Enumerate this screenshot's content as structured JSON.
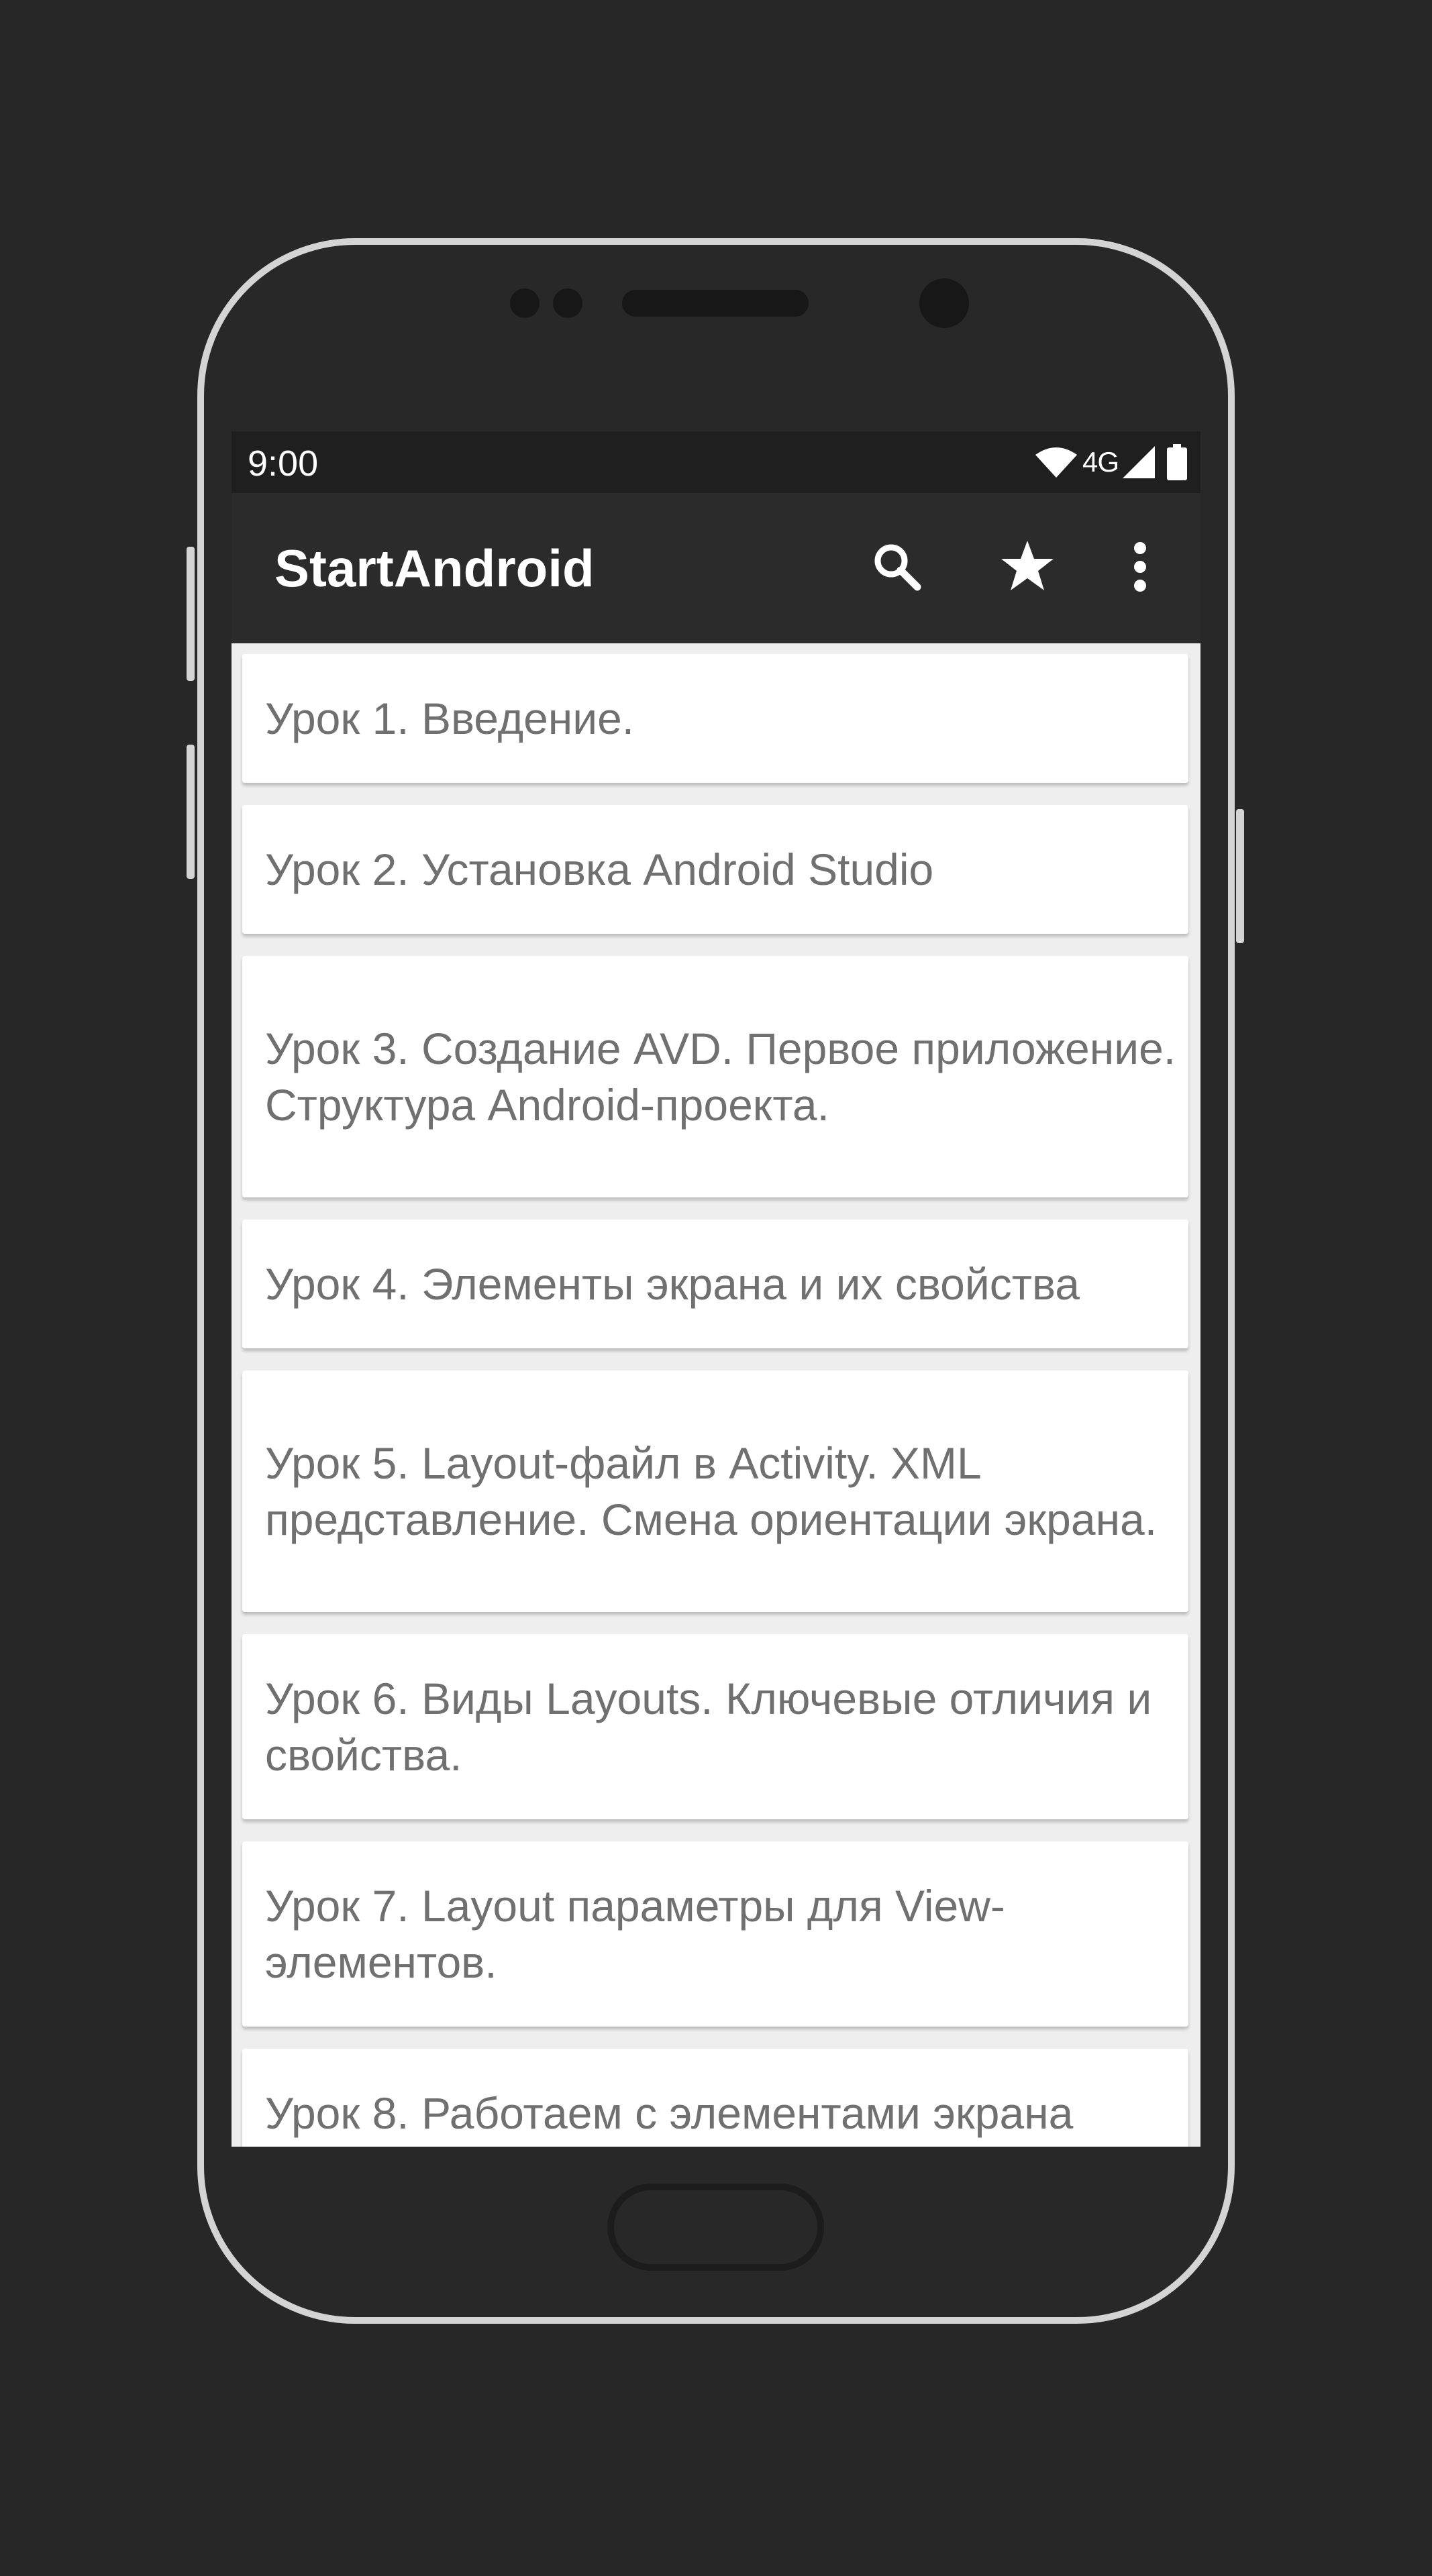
{
  "status_bar": {
    "time": "9:00",
    "network": "4G",
    "icons": [
      "wifi-icon",
      "signal-icon",
      "battery-icon"
    ]
  },
  "app_bar": {
    "title": "StartAndroid",
    "actions": [
      "search-icon",
      "star-icon",
      "more-vert-icon"
    ]
  },
  "lessons": [
    "Урок 1. Введение.",
    "Урок 2. Установка Android Studio",
    "Урок 3. Создание AVD. Первое приложение. Структура Android-проекта.",
    "Урок 4. Элементы экрана и их свойства",
    "Урок 5. Layout-файл в Activity. XML представление. Смена ориентации экрана.",
    "Урок 6. Виды Layouts. Ключевые отличия и свойства.",
    "Урок 7. Layout параметры для View-элементов.",
    "Урок 8. Работаем с элементами экрана"
  ],
  "colors": {
    "background": "#272727",
    "frame": "#d4d4d4",
    "app_bar": "#2b2b2b",
    "status_bar": "#1f1f1f",
    "list_background": "#eeeeee",
    "card": "#ffffff",
    "card_text": "#707070"
  }
}
